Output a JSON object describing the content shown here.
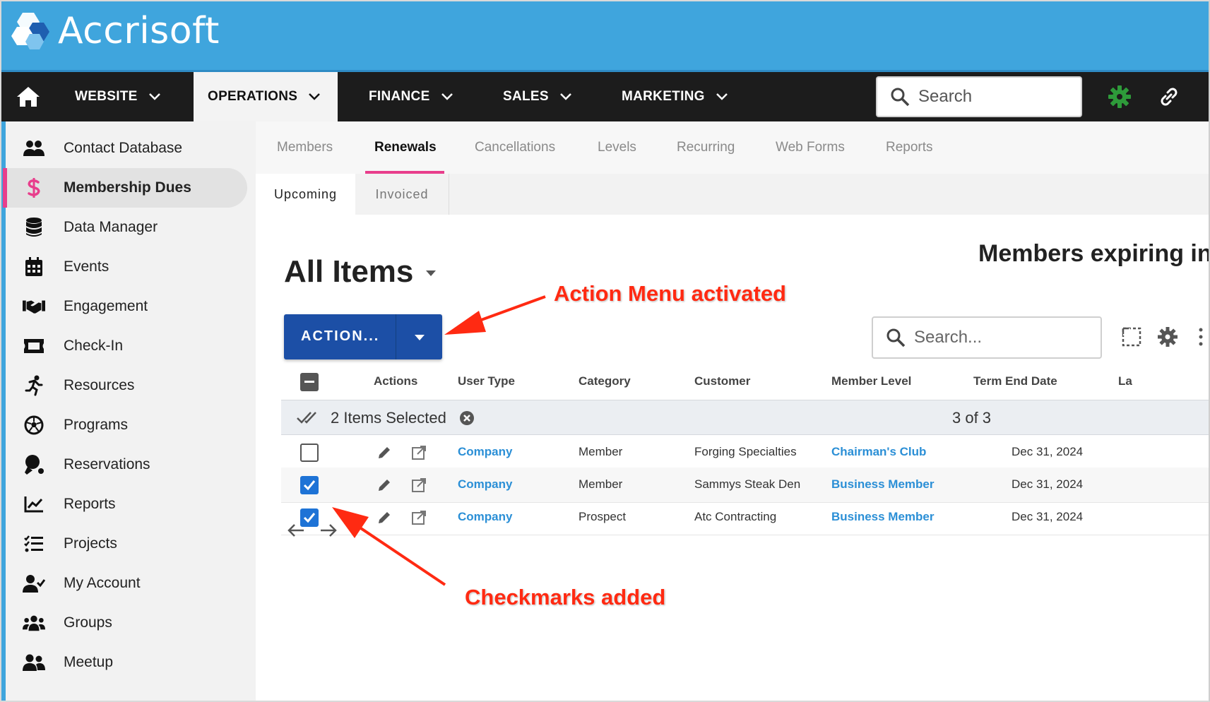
{
  "brand": {
    "name": "Accrisoft"
  },
  "nav": {
    "items": [
      {
        "label": "WEBSITE"
      },
      {
        "label": "OPERATIONS"
      },
      {
        "label": "FINANCE"
      },
      {
        "label": "SALES"
      },
      {
        "label": "MARKETING"
      }
    ],
    "active": "OPERATIONS",
    "search_placeholder": "Search",
    "accent_color": "#2e9b3a"
  },
  "sidebar": {
    "items": [
      {
        "label": "Contact Database",
        "icon": "contacts-icon"
      },
      {
        "label": "Membership Dues",
        "icon": "dollar-icon"
      },
      {
        "label": "Data Manager",
        "icon": "database-icon"
      },
      {
        "label": "Events",
        "icon": "calendar-icon"
      },
      {
        "label": "Engagement",
        "icon": "handshake-icon"
      },
      {
        "label": "Check-In",
        "icon": "ticket-icon"
      },
      {
        "label": "Resources",
        "icon": "running-icon"
      },
      {
        "label": "Programs",
        "icon": "soccer-ball-icon"
      },
      {
        "label": "Reservations",
        "icon": "ping-pong-icon"
      },
      {
        "label": "Reports",
        "icon": "chart-line-icon"
      },
      {
        "label": "Projects",
        "icon": "tasks-icon"
      },
      {
        "label": "My Account",
        "icon": "user-check-icon"
      },
      {
        "label": "Groups",
        "icon": "users-icon"
      },
      {
        "label": "Meetup",
        "icon": "user-friends-icon"
      }
    ],
    "active": "Membership Dues",
    "active_color": "#e83e8c"
  },
  "tabs": [
    {
      "label": "Members"
    },
    {
      "label": "Renewals"
    },
    {
      "label": "Cancellations"
    },
    {
      "label": "Levels"
    },
    {
      "label": "Recurring"
    },
    {
      "label": "Web Forms"
    },
    {
      "label": "Reports"
    }
  ],
  "active_tab": "Renewals",
  "subtabs": [
    {
      "label": "Upcoming"
    },
    {
      "label": "Invoiced"
    }
  ],
  "active_subtab": "Upcoming",
  "view": {
    "title": "All Items",
    "right_title": "Members expiring in",
    "action_label": "ACTION...",
    "search_placeholder": "Search..."
  },
  "table": {
    "columns": [
      "Actions",
      "User Type",
      "Category",
      "Customer",
      "Member Level",
      "Term End Date",
      "La"
    ],
    "selection_text": "2 Items Selected",
    "count_text": "3 of 3",
    "rows": [
      {
        "checked": false,
        "user_type": "Company",
        "category": "Member",
        "customer": "Forging Specialties",
        "member_level": "Chairman's Club",
        "term_end": "Dec 31, 2024"
      },
      {
        "checked": true,
        "user_type": "Company",
        "category": "Member",
        "customer": "Sammys Steak Den",
        "member_level": "Business Member",
        "term_end": "Dec 31, 2024"
      },
      {
        "checked": true,
        "user_type": "Company",
        "category": "Prospect",
        "customer": "Atc Contracting",
        "member_level": "Business Member",
        "term_end": "Dec 31, 2024"
      }
    ]
  },
  "annotations": {
    "action_menu": "Action Menu activated",
    "checkmarks": "Checkmarks added",
    "color": "#ff2a12"
  }
}
